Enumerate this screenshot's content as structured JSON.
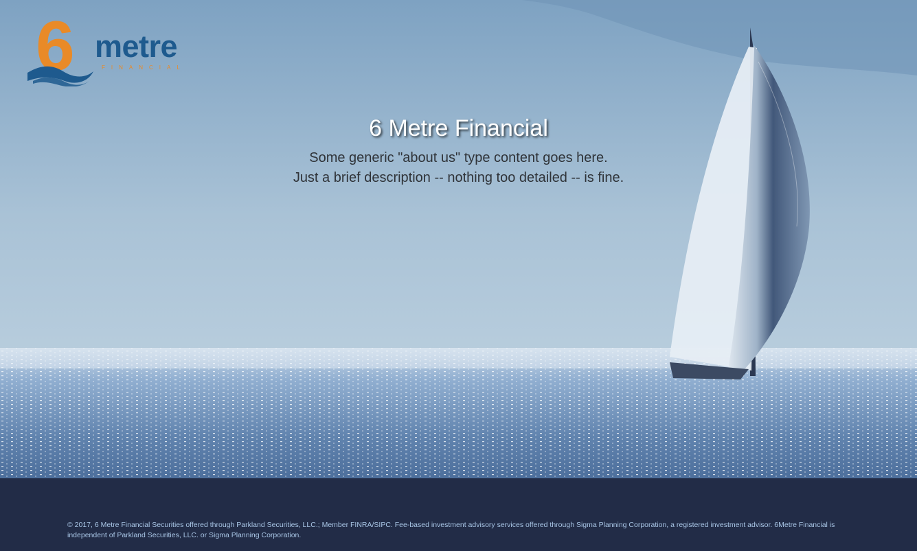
{
  "colors": {
    "sky_top": "#7fa3c3",
    "sky_mid": "#b9cfdf",
    "sea": "#5e7fa8",
    "logo_orange": "#e98a27",
    "logo_blue": "#1e5a8e",
    "footer_bg": "#222c47",
    "footer_text": "#a9c6e6"
  },
  "logo": {
    "numeral": "6",
    "word": "metre",
    "sub": "FINANCIAL"
  },
  "hero": {
    "title": "6 Metre Financial",
    "description_line1": "Some generic \"about us\" type content goes here.",
    "description_line2": "Just a brief description -- nothing too detailed -- is fine."
  },
  "footer": {
    "text": "© 2017, 6 Metre Financial Securities offered through Parkland Securities, LLC.; Member FINRA/SIPC. Fee-based investment advisory services offered through Sigma Planning Corporation, a registered investment advisor. 6Metre Financial is independent of Parkland Securities, LLC. or Sigma Planning Corporation."
  }
}
